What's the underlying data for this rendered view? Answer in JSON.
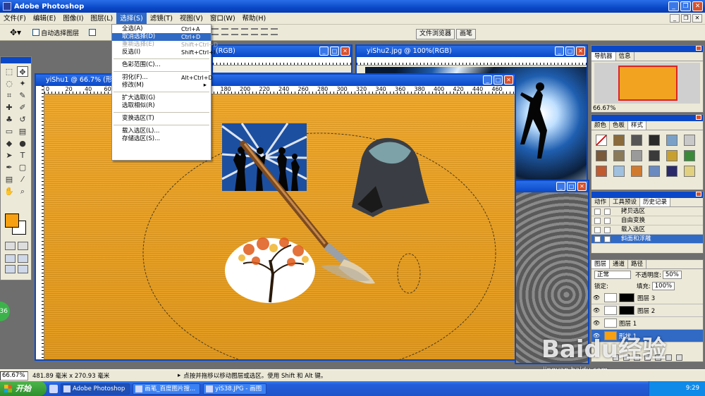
{
  "app": {
    "title": "Adobe Photoshop"
  },
  "menubar": [
    "文件(F)",
    "编辑(E)",
    "图像(I)",
    "图层(L)",
    "选择(S)",
    "滤镜(T)",
    "视图(V)",
    "窗口(W)",
    "帮助(H)"
  ],
  "options": {
    "auto_select_label": "自动选择图层"
  },
  "palette_well": [
    "文件浏览器",
    "画笔"
  ],
  "select_menu": {
    "items": [
      {
        "label": "全选(A)",
        "shortcut": "Ctrl+A"
      },
      {
        "label": "取消选择(D)",
        "shortcut": "Ctrl+D"
      },
      {
        "label": "重新选择(E)",
        "shortcut": "Shift+Ctrl+D"
      },
      {
        "label": "反选(I)",
        "shortcut": "Shift+Ctrl+I"
      },
      {
        "label": "色彩范围(C)..."
      },
      {
        "label": "羽化(F)...",
        "shortcut": "Alt+Ctrl+D"
      },
      {
        "label": "修改(M)"
      },
      {
        "label": "扩大选取(G)"
      },
      {
        "label": "选取相似(R)"
      },
      {
        "label": "变换选区(T)"
      },
      {
        "label": "载入选区(L)..."
      },
      {
        "label": "存储选区(S)..."
      }
    ]
  },
  "documents": {
    "main": "yiShu1 @ 66.7% (形状 1,RGB)",
    "behind1": "(RGB)",
    "yishu2": "yiShu2.jpg @ 100%(RGB)"
  },
  "ruler_numbers": [
    "0",
    "20",
    "40",
    "60",
    "80",
    "100",
    "120",
    "140",
    "160",
    "180",
    "200",
    "220",
    "240",
    "260",
    "280",
    "300",
    "320",
    "340",
    "360",
    "380",
    "400",
    "420",
    "440",
    "460"
  ],
  "navigator": {
    "tabs": [
      "导航器",
      "信息"
    ],
    "zoom": "66.67%"
  },
  "swatches": {
    "tabs": [
      "颜色",
      "色板",
      "样式"
    ]
  },
  "history": {
    "tabs": [
      "动作",
      "工具预设",
      "历史记录"
    ],
    "rows": [
      "拷贝选区",
      "自由变换",
      "载入选区",
      "斜面和浮雕"
    ]
  },
  "layers": {
    "tabs": [
      "图层",
      "通道",
      "路径"
    ],
    "blend_mode": "正常",
    "opacity_label": "不透明度:",
    "opacity": "50%",
    "lock_label": "锁定:",
    "fill_label": "填充:",
    "fill": "100%",
    "items": [
      "图层 3",
      "图层 2",
      "图层 1",
      "形状 1"
    ]
  },
  "status": {
    "zoom": "66.67%",
    "dimensions": "481.89 毫米 x 270.93 毫米",
    "hint": "点按并拖移以移动图层或选区。使用 Shift 和 Alt 键。"
  },
  "taskbar": {
    "start": "开始",
    "tasks": [
      "Adobe Photoshop",
      "画笔_百度图片搜...",
      "yiS38.JPG - 画图"
    ],
    "time": "9:29"
  },
  "green_badge": "36",
  "watermark": {
    "main": "Baidu经验",
    "sub": "jingyan.baidu.com"
  }
}
